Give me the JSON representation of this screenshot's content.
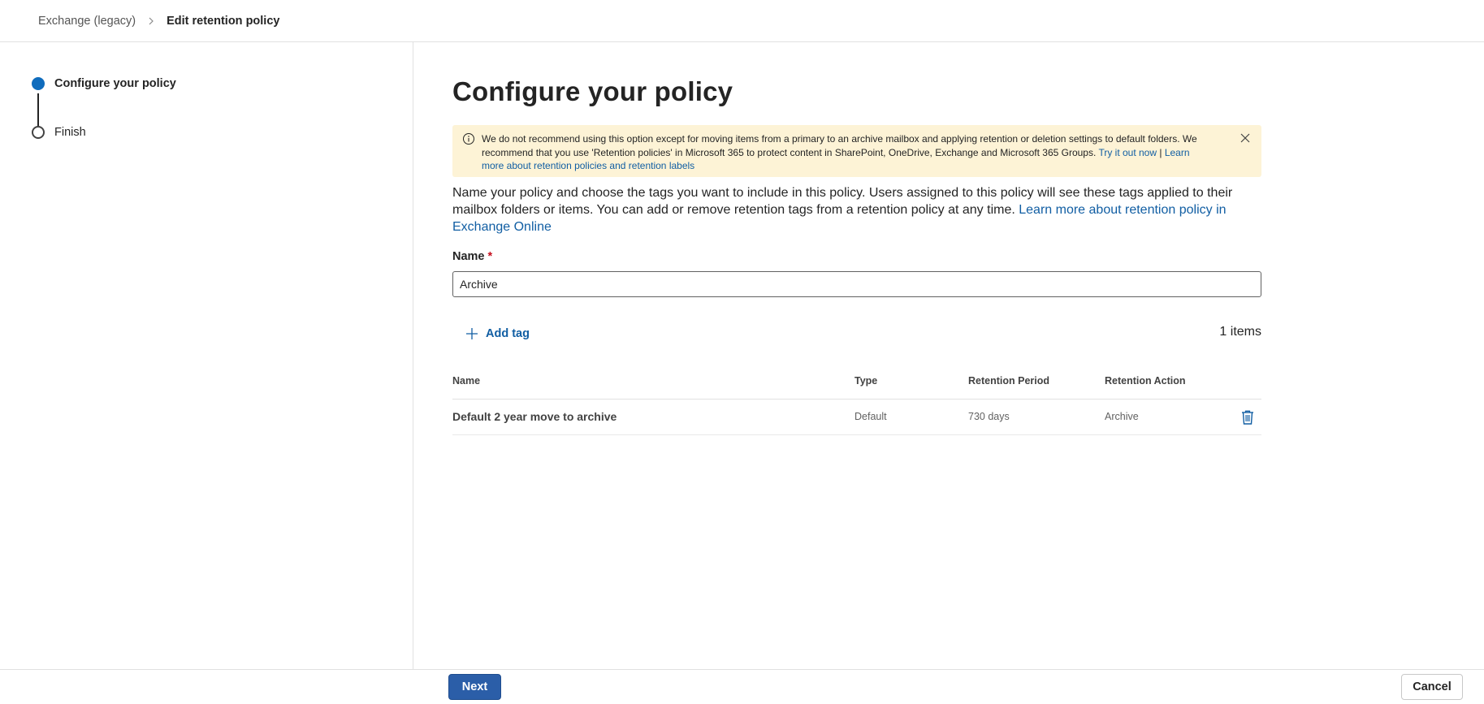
{
  "breadcrumb": {
    "parent": "Exchange (legacy)",
    "current": "Edit retention policy"
  },
  "steps": [
    {
      "label": "Configure your policy",
      "state": "active"
    },
    {
      "label": "Finish",
      "state": "pending"
    }
  ],
  "page": {
    "title": "Configure your policy"
  },
  "banner": {
    "text": "We do not recommend using this option except for moving items from a primary to an archive mailbox and applying retention or deletion settings to default folders. We recommend that you use 'Retention policies' in Microsoft 365 to protect content in SharePoint, OneDrive, Exchange and Microsoft 365 Groups. ",
    "link1": "Try it out now",
    "separator": " | ",
    "link2": "Learn more about retention policies and retention labels",
    "icon": "info-icon",
    "close_icon": "close-icon"
  },
  "description": {
    "text": "Name your policy and choose the tags you want to include in this policy. Users assigned to this policy will see these tags applied to their mailbox folders or items. You can add or remove retention tags from a retention policy at any time. ",
    "link": "Learn more about retention policy in Exchange Online"
  },
  "form": {
    "name_label": "Name",
    "required_marker": "*",
    "name_value": "Archive"
  },
  "toolbar": {
    "add_tag_label": "Add tag",
    "items_count": "1 items"
  },
  "table": {
    "headers": {
      "name": "Name",
      "type": "Type",
      "period": "Retention Period",
      "action": "Retention Action"
    },
    "rows": [
      {
        "name": "Default 2 year move to archive",
        "type": "Default",
        "period": "730 days",
        "action": "Archive"
      }
    ]
  },
  "footer": {
    "next_label": "Next",
    "cancel_label": "Cancel"
  },
  "colors": {
    "accent": "#0f6cbd",
    "link": "#115ea3",
    "banner_bg": "#fdf3d6",
    "primary_button": "#2b5ea8",
    "required": "#c50f1f"
  }
}
